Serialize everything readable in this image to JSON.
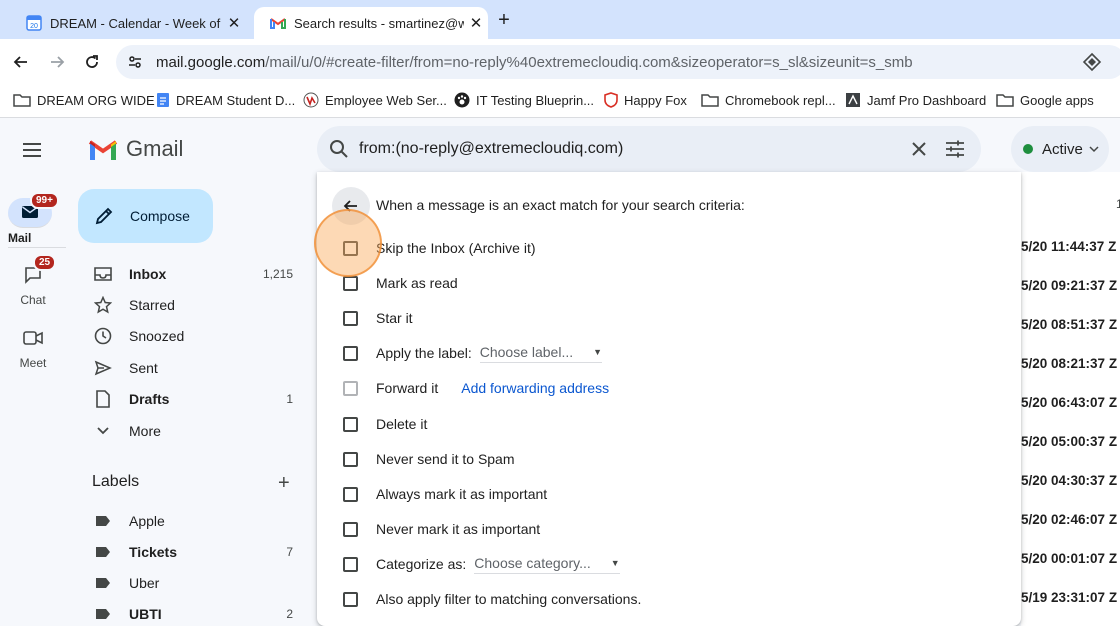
{
  "browser": {
    "tabs": [
      {
        "title": "DREAM - Calendar - Week of",
        "close": "✕"
      },
      {
        "title": "Search results - smartinez@w",
        "close": "✕"
      }
    ],
    "new_tab": "+",
    "url_host": "mail.google.com",
    "url_path": "/mail/u/0/#create-filter/from=no-reply%40extremecloudiq.com&sizeoperator=s_sl&sizeunit=s_smb",
    "bookmarks": [
      "DREAM ORG WIDE",
      "DREAM Student D...",
      "Employee Web Ser...",
      "IT Testing Blueprin...",
      "Happy Fox",
      "Chromebook repl...",
      "Jamf Pro Dashboard",
      "Google apps"
    ]
  },
  "gmail": {
    "logo_text": "Gmail",
    "rail": {
      "mail_label": "Mail",
      "mail_badge": "99+",
      "chat_label": "Chat",
      "chat_badge": "25",
      "meet_label": "Meet"
    },
    "compose_label": "Compose",
    "nav": [
      {
        "label": "Inbox",
        "count": "1,215",
        "bold": true
      },
      {
        "label": "Starred",
        "count": ""
      },
      {
        "label": "Snoozed",
        "count": ""
      },
      {
        "label": "Sent",
        "count": ""
      },
      {
        "label": "Drafts",
        "count": "1",
        "bold": true
      },
      {
        "label": "More",
        "count": ""
      }
    ],
    "labels_heading": "Labels",
    "labels_add": "+",
    "labels": [
      {
        "label": "Apple",
        "count": ""
      },
      {
        "label": "Tickets",
        "count": "7",
        "bold": true
      },
      {
        "label": "Uber",
        "count": ""
      },
      {
        "label": "UBTI",
        "count": "2",
        "bold": true
      }
    ],
    "search_query": "from:(no-reply@extremecloudiq.com)",
    "status": "Active",
    "page_indicator": "1",
    "timestamps": [
      "5/20 11:44:37 Z",
      "5/20 09:21:37 Z",
      "5/20 08:51:37 Z",
      "5/20 08:21:37 Z",
      "5/20 06:43:07 Z",
      "5/20 05:00:37 Z",
      "5/20 04:30:37 Z",
      "5/20 02:46:07 Z",
      "5/20 00:01:07 Z",
      "5/19 23:31:07 Z"
    ]
  },
  "filter": {
    "heading": "When a message is an exact match for your search criteria:",
    "options": {
      "skip_inbox": "Skip the Inbox (Archive it)",
      "mark_read": "Mark as read",
      "star": "Star it",
      "apply_label": "Apply the label:",
      "label_select": "Choose label...",
      "forward": "Forward it",
      "add_forwarding": "Add forwarding address",
      "delete": "Delete it",
      "never_spam": "Never send it to Spam",
      "always_important": "Always mark it as important",
      "never_important": "Never mark it as important",
      "categorize": "Categorize as:",
      "category_select": "Choose category...",
      "also_apply": "Also apply filter to matching conversations."
    }
  },
  "colors": {
    "tabbar": "#d3e3fd",
    "compose": "#c2e7ff",
    "link": "#0b57d0",
    "active_dot": "#1e8e3e",
    "badge": "#b3261e",
    "click_highlight": "#f5a55a"
  }
}
